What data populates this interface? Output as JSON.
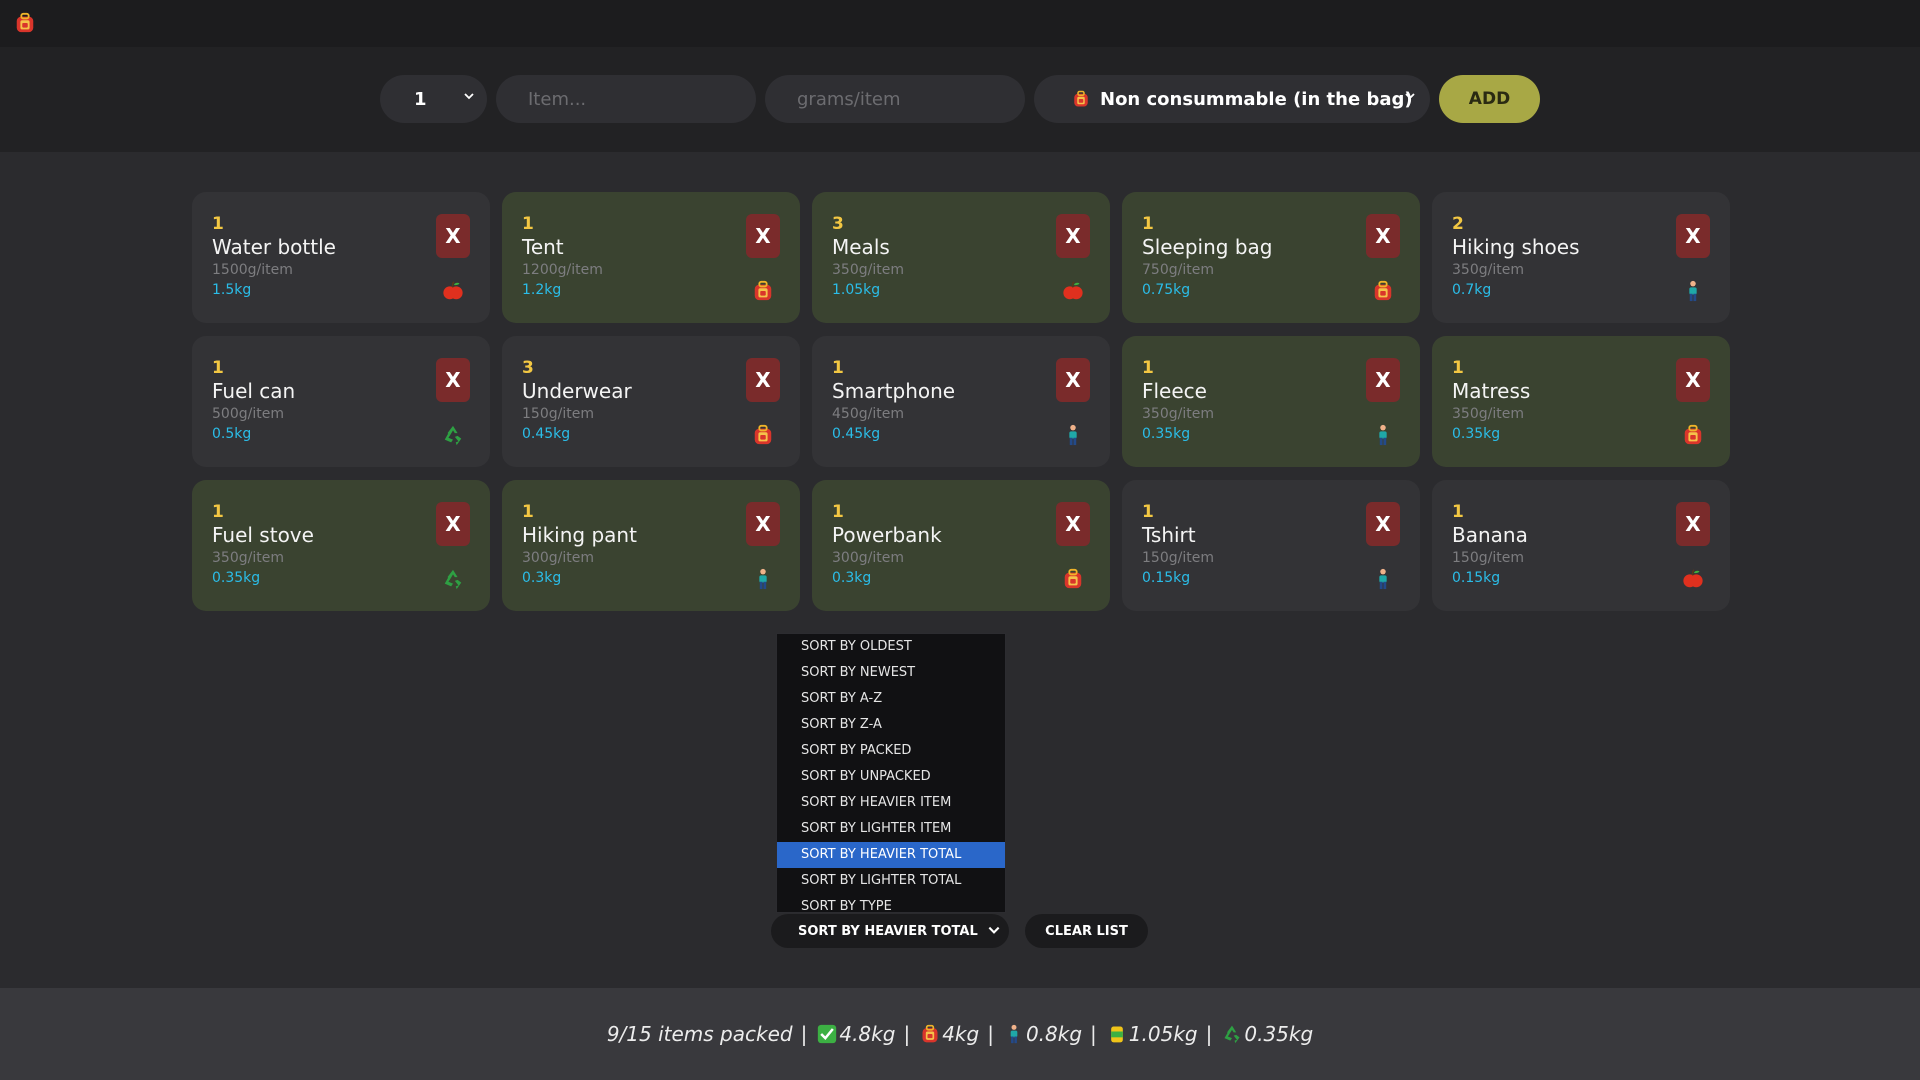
{
  "app": {
    "logo_icon": "backpack-icon"
  },
  "form": {
    "quantity": "1",
    "item_placeholder": "Item...",
    "grams_placeholder": "grams/item",
    "type_selected": "Non consummable (in the bag)",
    "type_icon": "backpack-icon",
    "add_label": "ADD"
  },
  "items": [
    {
      "qty": "1",
      "name": "Water bottle",
      "per": "1500g/item",
      "total": "1.5kg",
      "icon": "apple-icon",
      "packed": false,
      "x_label": "X"
    },
    {
      "qty": "1",
      "name": "Tent",
      "per": "1200g/item",
      "total": "1.2kg",
      "icon": "backpack-icon",
      "packed": true,
      "x_label": "X"
    },
    {
      "qty": "3",
      "name": "Meals",
      "per": "350g/item",
      "total": "1.05kg",
      "icon": "apple-icon",
      "packed": true,
      "x_label": "X"
    },
    {
      "qty": "1",
      "name": "Sleeping bag",
      "per": "750g/item",
      "total": "0.75kg",
      "icon": "backpack-icon",
      "packed": true,
      "x_label": "X"
    },
    {
      "qty": "2",
      "name": "Hiking shoes",
      "per": "350g/item",
      "total": "0.7kg",
      "icon": "person-icon",
      "packed": false,
      "x_label": "X"
    },
    {
      "qty": "1",
      "name": "Fuel can",
      "per": "500g/item",
      "total": "0.5kg",
      "icon": "recycle-icon",
      "packed": false,
      "x_label": "X"
    },
    {
      "qty": "3",
      "name": "Underwear",
      "per": "150g/item",
      "total": "0.45kg",
      "icon": "backpack-icon",
      "packed": false,
      "x_label": "X"
    },
    {
      "qty": "1",
      "name": "Smartphone",
      "per": "450g/item",
      "total": "0.45kg",
      "icon": "person-icon",
      "packed": false,
      "x_label": "X"
    },
    {
      "qty": "1",
      "name": "Fleece",
      "per": "350g/item",
      "total": "0.35kg",
      "icon": "person-icon",
      "packed": true,
      "x_label": "X"
    },
    {
      "qty": "1",
      "name": "Matress",
      "per": "350g/item",
      "total": "0.35kg",
      "icon": "backpack-icon",
      "packed": true,
      "x_label": "X"
    },
    {
      "qty": "1",
      "name": "Fuel stove",
      "per": "350g/item",
      "total": "0.35kg",
      "icon": "recycle-icon",
      "packed": true,
      "x_label": "X"
    },
    {
      "qty": "1",
      "name": "Hiking pant",
      "per": "300g/item",
      "total": "0.3kg",
      "icon": "person-icon",
      "packed": true,
      "x_label": "X"
    },
    {
      "qty": "1",
      "name": "Powerbank",
      "per": "300g/item",
      "total": "0.3kg",
      "icon": "backpack-icon",
      "packed": true,
      "x_label": "X"
    },
    {
      "qty": "1",
      "name": "Tshirt",
      "per": "150g/item",
      "total": "0.15kg",
      "icon": "person-icon",
      "packed": false,
      "x_label": "X"
    },
    {
      "qty": "1",
      "name": "Banana",
      "per": "150g/item",
      "total": "0.15kg",
      "icon": "apple-icon",
      "packed": false,
      "x_label": "X"
    }
  ],
  "sort": {
    "options": [
      "SORT BY OLDEST",
      "SORT BY NEWEST",
      "SORT BY A-Z",
      "SORT BY Z-A",
      "SORT BY PACKED",
      "SORT BY UNPACKED",
      "SORT BY HEAVIER ITEM",
      "SORT BY LIGHTER ITEM",
      "SORT BY HEAVIER TOTAL",
      "SORT BY LIGHTER TOTAL",
      "SORT BY TYPE"
    ],
    "selected_index": 8,
    "selected": "SORT BY HEAVIER TOTAL",
    "clear_label": "CLEAR LIST"
  },
  "footer": {
    "packed_text": "9/15 items packed",
    "total_packed": "4.8kg",
    "bag": "4kg",
    "worn": "0.8kg",
    "consumable": "1.05kg",
    "recyclable": "0.35kg",
    "sep": "|"
  },
  "colors": {
    "packed_card": "#3a4330",
    "unpacked_card": "#333336",
    "accent": "#a8a845",
    "quantity": "#f2c743",
    "total": "#2bbde8",
    "delete": "#7a2b2b",
    "selected_option": "#2a67c9"
  }
}
